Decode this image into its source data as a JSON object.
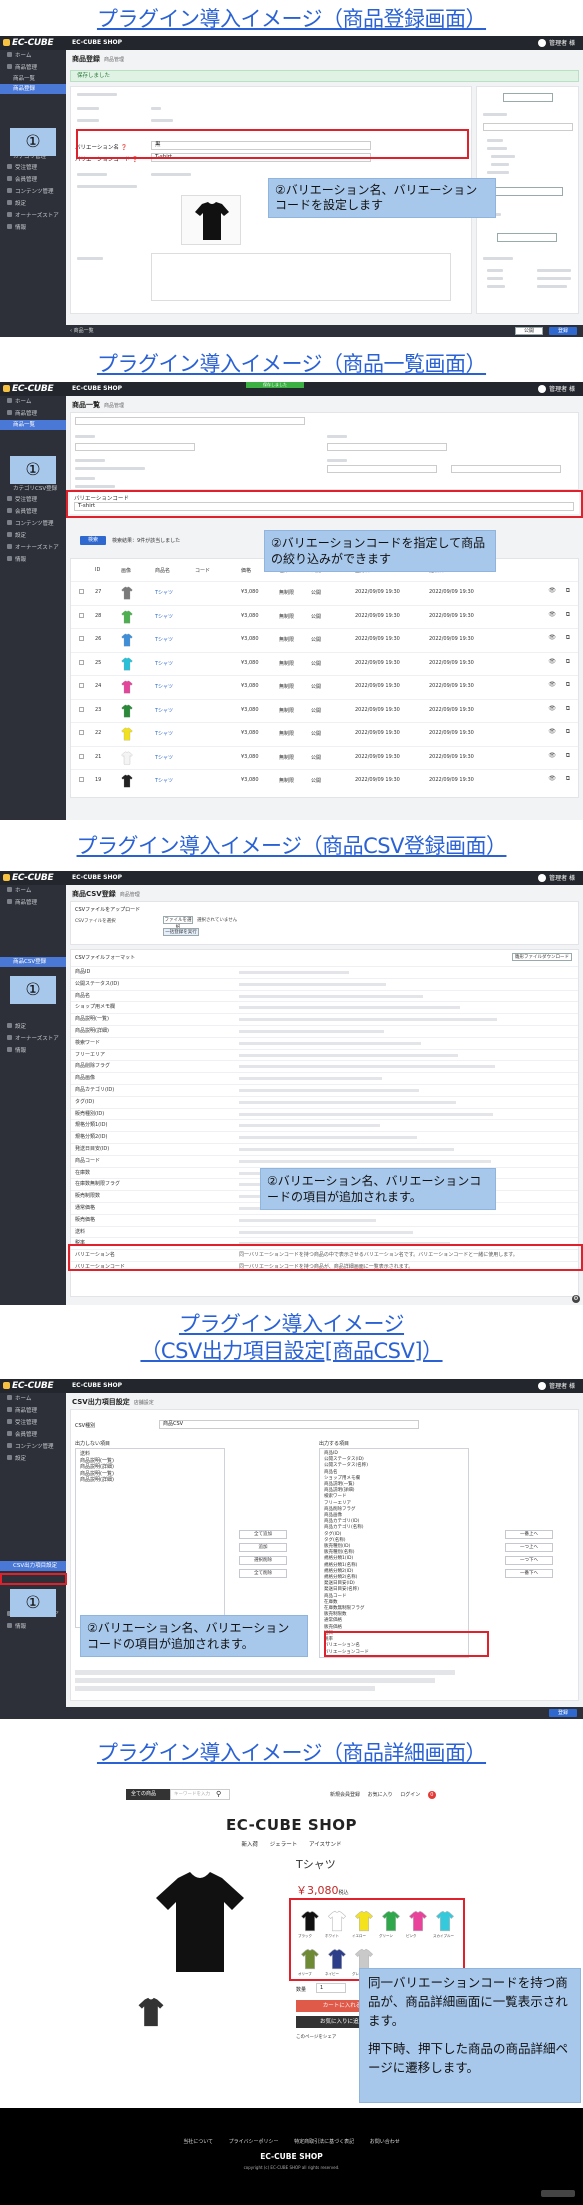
{
  "titles": {
    "s1": "プラグイン導入イメージ（商品登録画面）",
    "s2": "プラグイン導入イメージ（商品一覧画面）",
    "s3": "プラグイン導入イメージ（商品CSV登録画面）",
    "s4a": "プラグイン導入イメージ",
    "s4b": "（CSV出力項目設定[商品CSV]）",
    "s5": "プラグイン導入イメージ（商品詳細画面）"
  },
  "admin": {
    "logo": "EC-CUBE",
    "shop": "EC-CUBE SHOP",
    "user": "管理者 様",
    "sidebar": [
      "ホーム",
      "商品管理",
      "受注管理",
      "会員管理",
      "コンテンツ管理",
      "設定",
      "オーナーズストア",
      "情報"
    ]
  },
  "s1": {
    "page_title": "商品登録",
    "breadcrumb": "商品管理",
    "alert": "保存しました",
    "sidebar_active": "商品登録",
    "sub_items": [
      "商品一覧",
      "商品登録",
      "カテゴリ管理"
    ],
    "field_variation_name": "バリエーション名",
    "field_variation_code": "バリエーションコード",
    "val_variation_name": "黒",
    "val_variation_code": "T-shirt",
    "callout": "②バリエーション名、バリエーションコードを設定します",
    "circle": "①",
    "btn_register": "登録",
    "btn_public": "公開",
    "product_name": "Tシャツ"
  },
  "s2": {
    "page_title": "商品一覧",
    "breadcrumb": "商品管理",
    "green": "保存しました",
    "sidebar_active": "商品一覧",
    "filter_label": "バリエーションコード",
    "filter_value": "T-shirt",
    "search_btn": "検索",
    "result_text": "検索結果：9件が該当しました",
    "callout": "②バリエーションコードを指定して商品の絞り込みができます",
    "circle": "①",
    "columns": [
      "ID",
      "画像",
      "商品名",
      "コード",
      "価格",
      "在庫",
      "公開",
      "登録日",
      "更新日"
    ],
    "rows": [
      {
        "id": "27",
        "name": "Tシャツ",
        "price": "¥3,080",
        "stock": "無制限",
        "status": "公開",
        "date": "2022/09/09 19:30"
      },
      {
        "id": "28",
        "name": "Tシャツ",
        "price": "¥3,080",
        "stock": "無制限",
        "status": "公開",
        "date": "2022/09/09 19:30"
      },
      {
        "id": "26",
        "name": "Tシャツ",
        "price": "¥3,080",
        "stock": "無制限",
        "status": "公開",
        "date": "2022/09/09 19:30"
      },
      {
        "id": "25",
        "name": "Tシャツ",
        "price": "¥3,080",
        "stock": "無制限",
        "status": "公開",
        "date": "2022/09/09 19:30"
      },
      {
        "id": "24",
        "name": "Tシャツ",
        "price": "¥3,080",
        "stock": "無制限",
        "status": "公開",
        "date": "2022/09/09 19:30"
      },
      {
        "id": "23",
        "name": "Tシャツ",
        "price": "¥3,080",
        "stock": "無制限",
        "status": "公開",
        "date": "2022/09/09 19:30"
      },
      {
        "id": "22",
        "name": "Tシャツ",
        "price": "¥3,080",
        "stock": "無制限",
        "status": "公開",
        "date": "2022/09/09 19:30"
      },
      {
        "id": "21",
        "name": "Tシャツ",
        "price": "¥3,080",
        "stock": "無制限",
        "status": "公開",
        "date": "2022/09/09 19:30"
      },
      {
        "id": "19",
        "name": "Tシャツ",
        "price": "¥3,080",
        "stock": "無制限",
        "status": "公開",
        "date": "2022/09/09 19:30"
      }
    ],
    "shirt_colors": [
      "#7a7a7a",
      "#4caf50",
      "#3f8fd8",
      "#27c0d8",
      "#e3459a",
      "#2a8a3a",
      "#f0e020",
      "#f4f4f4",
      "#222222"
    ]
  },
  "s3": {
    "page_title": "商品CSV登録",
    "breadcrumb": "商品管理",
    "sidebar_active": "商品CSV登録",
    "upload_label": "CSVファイルをアップロード",
    "file_btn": "ファイルを選択",
    "file_none": "選択されていません",
    "upload_btn": "一括登録を実行",
    "format_label": "CSVファイルフォーマット",
    "template_btn": "雛形ファイルダウンロード",
    "rows": [
      "商品ID",
      "公開ステータス(ID)",
      "商品名",
      "ショップ用メモ欄",
      "商品説明(一覧)",
      "商品説明(詳細)",
      "検索ワード",
      "フリーエリア",
      "商品削除フラグ",
      "商品画像",
      "商品カテゴリ(ID)",
      "タグ(ID)",
      "販売種別(ID)",
      "規格分類1(ID)",
      "規格分類2(ID)",
      "発送日目安(ID)",
      "商品コード",
      "在庫数",
      "在庫数無制限フラグ",
      "販売制限数",
      "通常価格",
      "販売価格",
      "送料",
      "税率"
    ],
    "var_name_row": "バリエーション名",
    "var_code_row": "バリエーションコード",
    "var_name_desc": "同一バリエーションコードを持つ商品の中で表示させるバリエーション名です。バリエーションコードと一緒に使用します。",
    "var_code_desc": "同一バリエーションコードを持つ商品が、商品詳細画面に一覧表示されます。",
    "callout": "②バリエーション名、バリエーションコードの項目が追加されます。",
    "circle": "①"
  },
  "s4": {
    "page_title": "CSV出力項目設定",
    "breadcrumb": "店舗設定",
    "sidebar_active": "CSV出力項目設定",
    "csv_type_label": "CSV種別",
    "csv_type_value": "商品CSV",
    "left_header": "出力しない項目",
    "right_header": "出力する項目",
    "left_items": [
      "送料",
      "商品説明(一覧)",
      "商品説明(詳細)",
      "商品説明(一覧)",
      "商品説明(詳細)"
    ],
    "right_items": [
      "商品ID",
      "公開ステータス(ID)",
      "公開ステータス(名称)",
      "商品名",
      "ショップ用メモ欄",
      "商品説明(一覧)",
      "商品説明(詳細)",
      "検索ワード",
      "フリーエリア",
      "商品削除フラグ",
      "商品画像",
      "商品カテゴリ(ID)",
      "商品カテゴリ(名称)",
      "タグ(ID)",
      "タグ(名称)",
      "販売種別(ID)",
      "販売種別(名称)",
      "規格分類1(ID)",
      "規格分類1(名称)",
      "規格分類2(ID)",
      "規格分類2(名称)",
      "発送日目安(ID)",
      "発送日目安(名称)",
      "商品コード",
      "在庫数",
      "在庫数無制限フラグ",
      "販売制限数",
      "通常価格",
      "販売価格",
      "送料",
      "税率",
      "バリエーション名",
      "バリエーションコード"
    ],
    "mid_buttons": [
      "全て追加",
      "追加",
      "選択削除",
      "全て削除"
    ],
    "right_buttons": [
      "一番上へ",
      "一つ上へ",
      "一つ下へ",
      "一番下へ"
    ],
    "callout": "②バリエーション名、バリエーションコードの項目が追加されます。",
    "circle": "①",
    "register_btn": "登録"
  },
  "s5": {
    "nav_select": "全ての商品",
    "nav_search_placeholder": "キーワードを入力",
    "nav_links": [
      "新規会員登録",
      "お気に入り",
      "ログイン",
      "0",
      "0"
    ],
    "shop_title": "EC-CUBE SHOP",
    "categories": [
      "新入荷",
      "ジェラート",
      "アイスサンド"
    ],
    "product_name": "Tシャツ",
    "price": "￥3,080",
    "price_note": "税込",
    "swatches": [
      "#111111",
      "#ffffff",
      "#f4e21c",
      "#2ea84a",
      "#e8429a",
      "#35c9dc",
      "#6f8a34",
      "#2c3e8a",
      "#c9c9c9"
    ],
    "swatch_labels": [
      "ブラック",
      "ホワイト",
      "イエロー",
      "グリーン",
      "ピンク",
      "スカイブルー",
      "オリーブ",
      "ネイビー",
      "グレー"
    ],
    "qty_label": "数量",
    "qty_value": "1",
    "cart_btn": "カートに入れる",
    "fav_btn": "お気に入りに追加",
    "share": "このページをシェア",
    "callout_1": "同一バリエーションコードを持つ商品が、商品詳細画面に一覧表示されます。",
    "callout_2": "押下時、押下した商品の商品詳細ページに遷移します。",
    "footer_links": [
      "当社について",
      "プライバシーポリシー",
      "特定商取引法に基づく表記",
      "お問い合わせ"
    ],
    "footer_title": "EC-CUBE SHOP",
    "copyright": "copyright (c) EC-CUBE SHOP all rights reserved."
  }
}
